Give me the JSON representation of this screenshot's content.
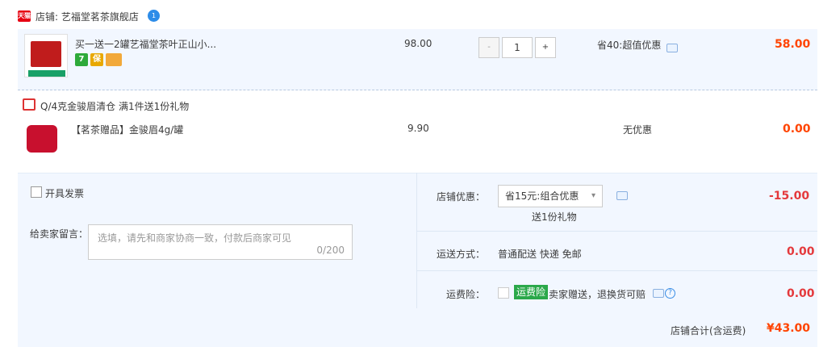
{
  "shop": {
    "badge": "天猫",
    "label": "店铺: 艺福堂茗茶旗舰店",
    "wangwang_badge": "1"
  },
  "item": {
    "title": "买一送一2罐艺福堂茶叶正山小...",
    "price": "98.00",
    "quantity": "1",
    "qty_minus": "-",
    "qty_plus": "+",
    "discount": "省40:超值优惠",
    "total": "58.00",
    "services": [
      {
        "icon": "seven-day-return-icon",
        "text": "7"
      },
      {
        "icon": "guarantee-icon",
        "text": "保"
      },
      {
        "icon": "credit-card-icon",
        "text": ""
      }
    ]
  },
  "gift": {
    "header": "Q/4克金骏眉清仓   满1件送1份礼物",
    "title": "【茗茶赠品】金骏眉4g/罐",
    "price": "9.90",
    "discount": "无优惠",
    "total": "0.00"
  },
  "invoice": {
    "label": "开具发票"
  },
  "message": {
    "label": "给卖家留言：",
    "placeholder": "选填，请先和商家协商一致，付款后商家可见",
    "count": "0/200"
  },
  "shop_discount": {
    "label": "店铺优惠：",
    "selected": "省15元:组合优惠",
    "gift_note": "送1份礼物",
    "amount": "-15.00"
  },
  "shipping": {
    "label": "运送方式：",
    "value": "普通配送 快递 免邮",
    "amount": "0.00"
  },
  "insurance": {
    "label": "运费险：",
    "badge": "运费险",
    "text": "卖家赠送，退换货可赔",
    "help": "?",
    "amount": "0.00"
  },
  "summary": {
    "label": "店铺合计(含运费)",
    "value": "¥43.00"
  },
  "colors": {
    "accent": "#ff4400",
    "panel_bg": "#f2f7ff",
    "insurance_green": "#2ba84a",
    "tmall_red": "#e60012"
  }
}
